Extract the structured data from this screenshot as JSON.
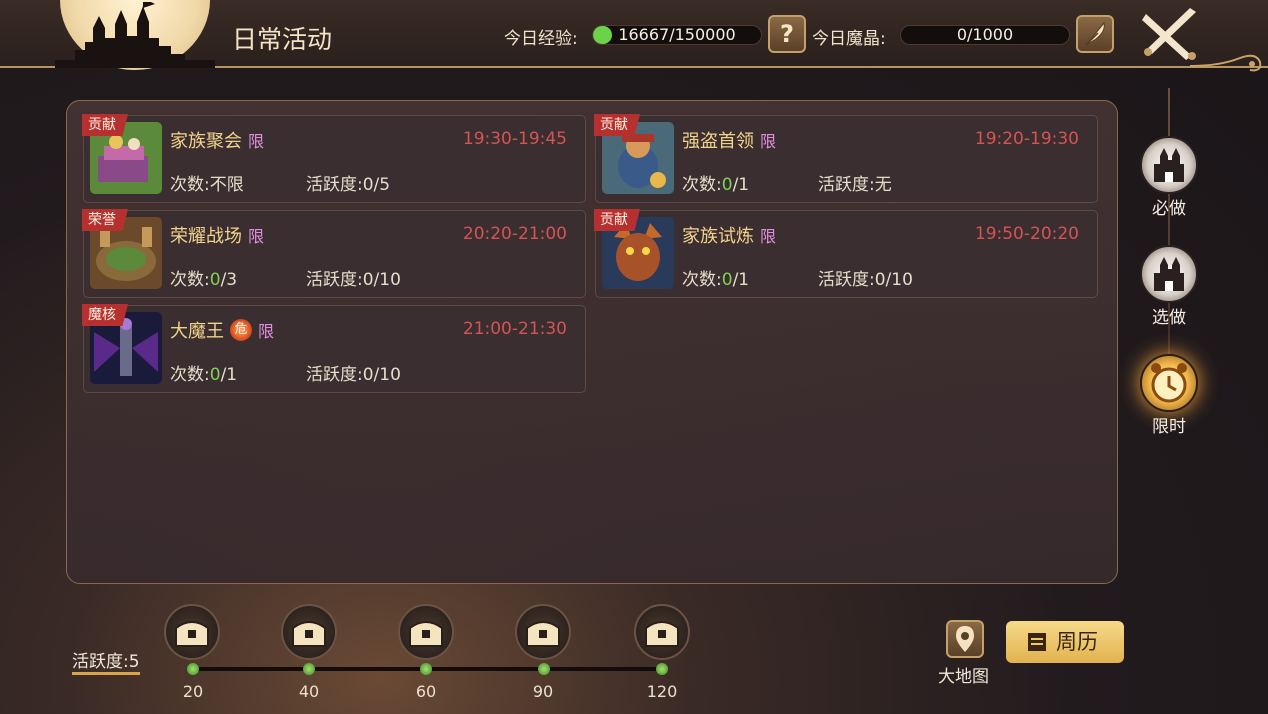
{
  "header": {
    "title": "日常活动",
    "exp_label": "今日经验:",
    "exp_value": "16667/150000",
    "exp_progress": 0.111,
    "help_icon": "?",
    "crystal_label": "今日魔晶:",
    "crystal_value": "0/1000"
  },
  "activities": [
    {
      "tag": "贡献",
      "name": "家族聚会",
      "limit": "限",
      "time": "19:30-19:45",
      "count_label": "次数:",
      "count_done": "",
      "count_rest": "不限",
      "active": "活跃度:0/5"
    },
    {
      "tag": "贡献",
      "name": "强盗首领",
      "limit": "限",
      "time": "19:20-19:30",
      "count_label": "次数:",
      "count_done": "0",
      "count_rest": "/1",
      "active": "活跃度:无"
    },
    {
      "tag": "荣誉",
      "name": "荣耀战场",
      "limit": "限",
      "time": "20:20-21:00",
      "count_label": "次数:",
      "count_done": "0",
      "count_rest": "/3",
      "active": "活跃度:0/10"
    },
    {
      "tag": "贡献",
      "name": "家族试炼",
      "limit": "限",
      "time": "19:50-20:20",
      "count_label": "次数:",
      "count_done": "0",
      "count_rest": "/1",
      "active": "活跃度:0/10"
    },
    {
      "tag": "魔核",
      "name": "大魔王",
      "danger": "危",
      "limit": "限",
      "time": "21:00-21:30",
      "count_label": "次数:",
      "count_done": "0",
      "count_rest": "/1",
      "active": "活跃度:0/10"
    }
  ],
  "side_tabs": [
    {
      "label": "必做",
      "icon": "castle-icon"
    },
    {
      "label": "选做",
      "icon": "castle-icon"
    },
    {
      "label": "限时",
      "icon": "alarm-clock-icon",
      "active": true
    }
  ],
  "activity_progress": {
    "label": "活跃度:5",
    "thresholds": [
      "20",
      "40",
      "60",
      "90",
      "120"
    ]
  },
  "footer": {
    "map_label": "大地图",
    "calendar_label": "周历"
  },
  "colors": {
    "tag_red": "#b6302f",
    "time_red": "#d45454",
    "name_gold": "#f2d38b",
    "limit_purple": "#e08fde",
    "done_green": "#7cd257"
  }
}
